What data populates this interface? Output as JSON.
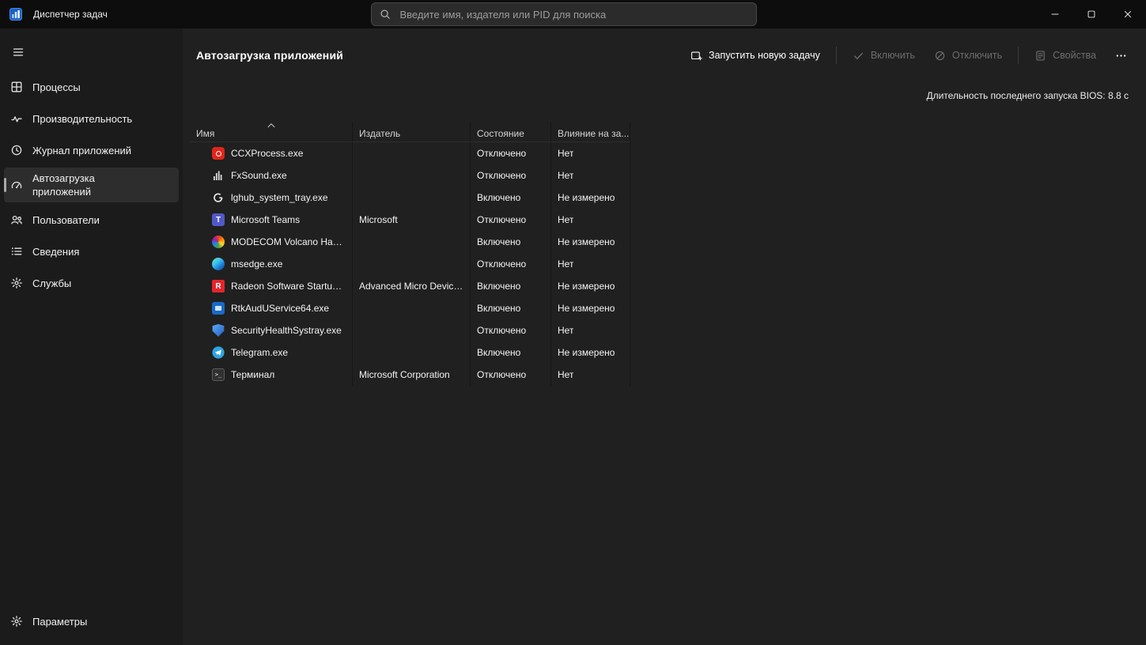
{
  "titlebar": {
    "app_title": "Диспетчер задач",
    "search_placeholder": "Введите имя, издателя или PID для поиска"
  },
  "sidebar": {
    "items": [
      {
        "id": "processes",
        "label": "Процессы",
        "icon": "processes-icon",
        "selected": false
      },
      {
        "id": "performance",
        "label": "Производительность",
        "icon": "performance-icon",
        "selected": false
      },
      {
        "id": "app-history",
        "label": "Журнал приложений",
        "icon": "app-history-icon",
        "selected": false
      },
      {
        "id": "startup-apps",
        "label": "Автозагрузка приложений",
        "icon": "startup-apps-icon",
        "selected": true
      },
      {
        "id": "users",
        "label": "Пользователи",
        "icon": "users-icon",
        "selected": false
      },
      {
        "id": "details",
        "label": "Сведения",
        "icon": "details-icon",
        "selected": false
      },
      {
        "id": "services",
        "label": "Службы",
        "icon": "services-icon",
        "selected": false
      }
    ],
    "settings": {
      "label": "Параметры",
      "icon": "settings-gear-icon"
    }
  },
  "main": {
    "page_title": "Автозагрузка приложений",
    "toolbar": {
      "run_new_task_label": "Запустить новую задачу",
      "enable_label": "Включить",
      "disable_label": "Отключить",
      "properties_label": "Свойства"
    },
    "bios_text": "Длительность последнего запуска BIOS: 8.8 с",
    "table": {
      "sort": {
        "column": "name",
        "direction": "asc"
      },
      "columns": [
        {
          "id": "name",
          "label": "Имя",
          "sorted": "asc"
        },
        {
          "id": "publisher",
          "label": "Издатель",
          "sorted": null
        },
        {
          "id": "status",
          "label": "Состояние",
          "sorted": null
        },
        {
          "id": "impact",
          "label": "Влияние на за...",
          "sorted": null
        }
      ],
      "rows": [
        {
          "icon": "ccx",
          "name": "CCXProcess.exe",
          "publisher": "",
          "status": "Отключено",
          "impact": "Нет"
        },
        {
          "icon": "fxsound",
          "name": "FxSound.exe",
          "publisher": "",
          "status": "Отключено",
          "impact": "Нет"
        },
        {
          "icon": "lghub",
          "name": "lghub_system_tray.exe",
          "publisher": "",
          "status": "Включено",
          "impact": "Не измерено"
        },
        {
          "icon": "teams",
          "name": "Microsoft Teams",
          "publisher": "Microsoft",
          "status": "Отключено",
          "impact": "Нет"
        },
        {
          "icon": "modecom",
          "name": "MODECOM Volcano Ham...",
          "publisher": "",
          "status": "Включено",
          "impact": "Не измерено"
        },
        {
          "icon": "edge",
          "name": "msedge.exe",
          "publisher": "",
          "status": "Отключено",
          "impact": "Нет"
        },
        {
          "icon": "radeon",
          "name": "Radeon Software Startup T...",
          "publisher": "Advanced Micro Device...",
          "status": "Включено",
          "impact": "Не измерено"
        },
        {
          "icon": "rtk",
          "name": "RtkAudUService64.exe",
          "publisher": "",
          "status": "Включено",
          "impact": "Не измерено"
        },
        {
          "icon": "security",
          "name": "SecurityHealthSystray.exe",
          "publisher": "",
          "status": "Отключено",
          "impact": "Нет"
        },
        {
          "icon": "telegram",
          "name": "Telegram.exe",
          "publisher": "",
          "status": "Включено",
          "impact": "Не измерено"
        },
        {
          "icon": "terminal",
          "name": "Терминал",
          "publisher": "Microsoft Corporation",
          "status": "Отключено",
          "impact": "Нет"
        }
      ]
    }
  }
}
